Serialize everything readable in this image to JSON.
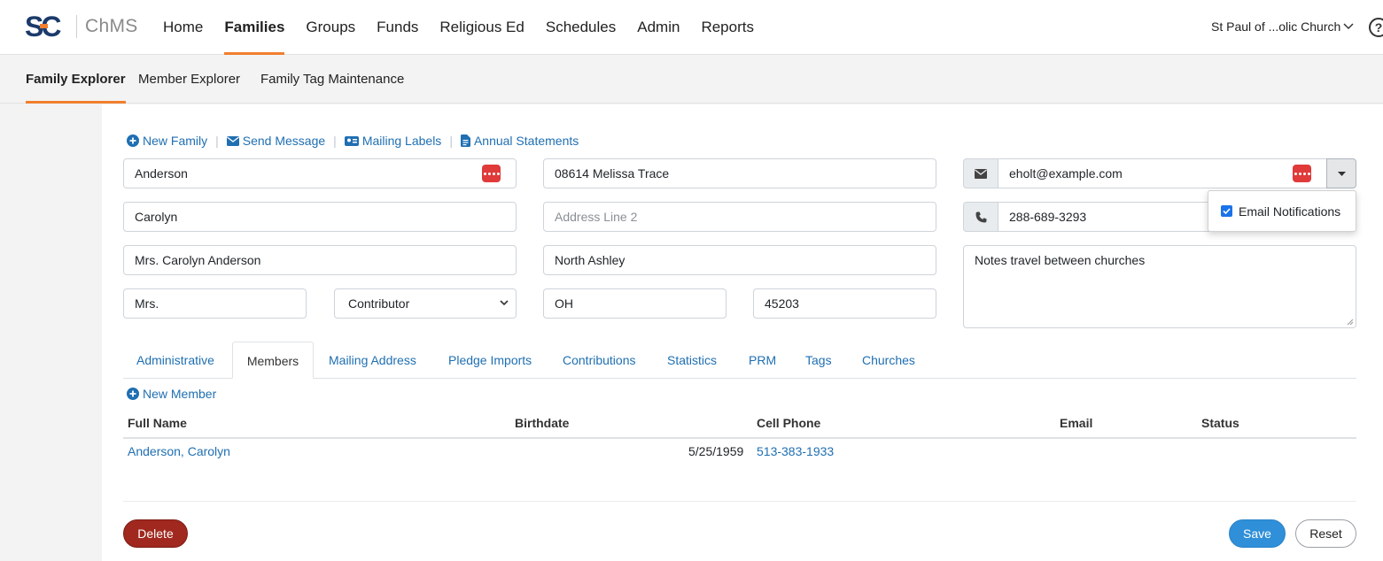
{
  "app": {
    "logo_text": "SC",
    "name": "ChMS"
  },
  "nav": {
    "items": [
      {
        "label": "Home"
      },
      {
        "label": "Families"
      },
      {
        "label": "Groups"
      },
      {
        "label": "Funds"
      },
      {
        "label": "Religious Ed"
      },
      {
        "label": "Schedules"
      },
      {
        "label": "Admin"
      },
      {
        "label": "Reports"
      }
    ],
    "active": "Families",
    "church": "St Paul of ...olic Church",
    "help": "?"
  },
  "subnav": {
    "items": [
      {
        "label": "Family Explorer"
      },
      {
        "label": "Member Explorer"
      },
      {
        "label": "Family Tag Maintenance"
      }
    ],
    "active": "Family Explorer"
  },
  "actions": {
    "new_family": "New Family",
    "send_message": "Send Message",
    "mailing_labels": "Mailing Labels",
    "annual_statements": "Annual Statements",
    "separator": "|"
  },
  "form": {
    "last_name": "Anderson",
    "first_name": "Carolyn",
    "formal_name": "Mrs. Carolyn Anderson",
    "title": "Mrs.",
    "family_type": "Contributor",
    "address1": "08614 Melissa Trace",
    "address2_placeholder": "Address Line 2",
    "city": "North Ashley",
    "state": "OH",
    "zip": "45203",
    "email": "eholt@example.com",
    "phone": "288-689-3293",
    "notes": "Notes travel between churches"
  },
  "email_popup": {
    "label": "Email Notifications",
    "checked": true
  },
  "tabs": {
    "items": [
      {
        "label": "Administrative"
      },
      {
        "label": "Members"
      },
      {
        "label": "Mailing Address"
      },
      {
        "label": "Pledge Imports"
      },
      {
        "label": "Contributions"
      },
      {
        "label": "Statistics"
      },
      {
        "label": "PRM"
      },
      {
        "label": "Tags"
      },
      {
        "label": "Churches"
      }
    ],
    "active": "Members"
  },
  "members": {
    "new_member": "New Member",
    "columns": [
      "Full Name",
      "Birthdate",
      "Cell Phone",
      "Email",
      "Status"
    ],
    "rows": [
      {
        "full_name": "Anderson, Carolyn",
        "birthdate": "5/25/1959",
        "cell_phone": "513-383-1933",
        "email": "",
        "status": ""
      }
    ]
  },
  "buttons": {
    "delete": "Delete",
    "save": "Save",
    "reset": "Reset"
  },
  "colors": {
    "accent": "#f07f2e",
    "link": "#1f6fb2",
    "delete": "#a0281e",
    "save": "#2f8fd8",
    "logo_blue": "#1b3a6b"
  }
}
